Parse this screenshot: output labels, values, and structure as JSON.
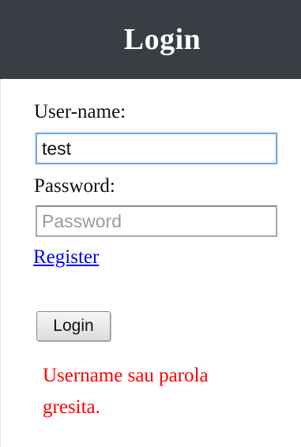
{
  "header": {
    "title": "Login"
  },
  "form": {
    "username_label": "User-name:",
    "username_value": "test",
    "password_label": "Password:",
    "password_placeholder": "Password",
    "register_link": "Register",
    "login_button": "Login",
    "error_message": "Username sau parola gresita."
  },
  "colors": {
    "header_bg": "#393d44",
    "error": "#ff0000",
    "link": "#0000ee",
    "focus_border": "#7aa7e0"
  }
}
